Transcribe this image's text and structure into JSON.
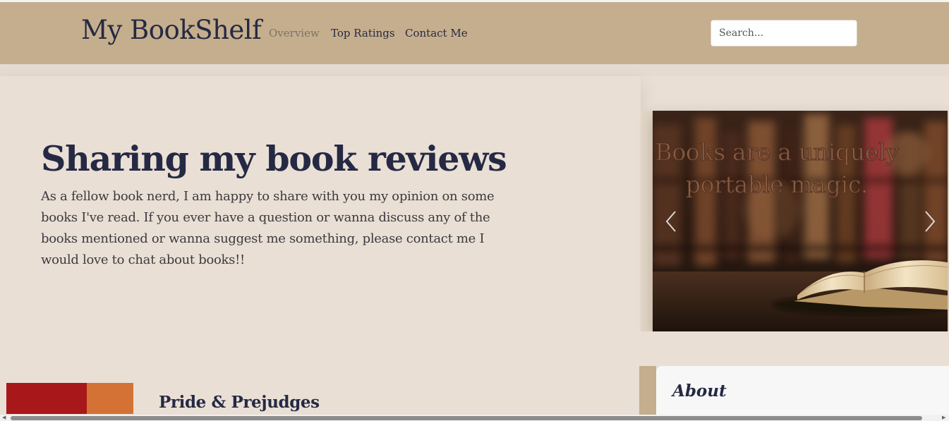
{
  "navbar": {
    "brand": "My BookShelf",
    "links": [
      "Overview",
      "Top Ratings",
      "Contact Me"
    ],
    "search_placeholder": "Search..."
  },
  "hero": {
    "title": "Sharing my book reviews",
    "text": "As a fellow book nerd, I am happy to share with you my opinion on some books I've read. If you ever have a question or wanna discuss any of the books mentioned or wanna suggest me something, please contact me I would love to chat about books!!"
  },
  "carousel": {
    "quote": "Books are a uniquely portable magic.",
    "prev_icon": "chevron-left-icon",
    "next_icon": "chevron-right-icon"
  },
  "books": [
    {
      "title": "Pride & Prejudges",
      "cover_colors": [
        "#a8171a",
        "#d37234"
      ]
    }
  ],
  "about": {
    "heading": "About"
  },
  "colors": {
    "navbar_bg": "#c5ae8d",
    "page_bg": "#e9dfd5",
    "text_dark": "#252943",
    "active_link": "#7a7468"
  }
}
